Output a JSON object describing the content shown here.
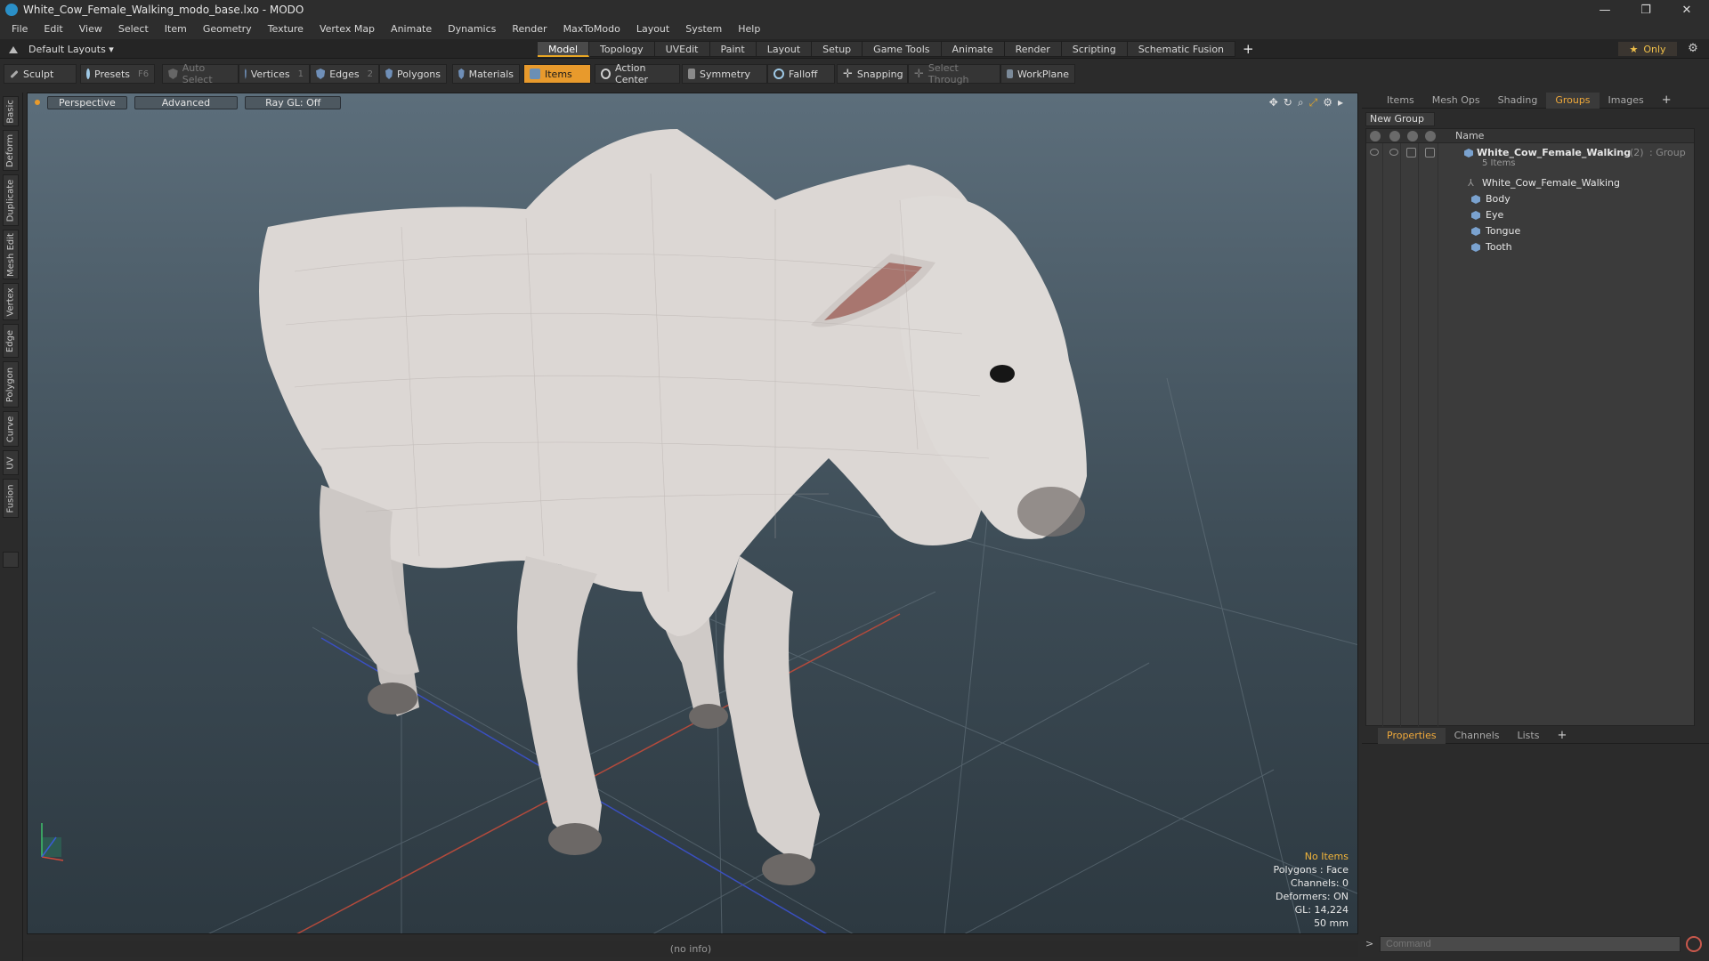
{
  "window": {
    "title": "White_Cow_Female_Walking_modo_base.lxo - MODO",
    "controls": [
      "—",
      "❐",
      "✕"
    ]
  },
  "menu": [
    "File",
    "Edit",
    "View",
    "Select",
    "Item",
    "Geometry",
    "Texture",
    "Vertex Map",
    "Animate",
    "Dynamics",
    "Render",
    "MaxToModo",
    "Layout",
    "System",
    "Help"
  ],
  "layout": {
    "selector": "Default Layouts ▾",
    "tabs": [
      "Model",
      "Topology",
      "UVEdit",
      "Paint",
      "Layout",
      "Setup",
      "Game Tools",
      "Animate",
      "Render",
      "Scripting",
      "Schematic Fusion"
    ],
    "active_tab": "Model",
    "add": "+",
    "only": "Only",
    "star": "★"
  },
  "toolbar": {
    "sculpt": "Sculpt",
    "presets": "Presets",
    "presets_key": "F6",
    "auto_select": "Auto Select",
    "vertices": "Vertices",
    "vertices_key": "1",
    "edges": "Edges",
    "edges_key": "2",
    "polygons": "Polygons",
    "materials": "Materials",
    "items": "Items",
    "action_center": "Action Center",
    "symmetry": "Symmetry",
    "falloff": "Falloff",
    "snapping": "Snapping",
    "select_through": "Select Through",
    "workplane": "WorkPlane"
  },
  "left_tabs": [
    "Basic",
    "Deform",
    "Duplicate",
    "Mesh Edit",
    "Vertex",
    "Edge",
    "Polygon",
    "Curve",
    "UV",
    "Fusion"
  ],
  "viewport": {
    "view": "Perspective",
    "mode": "Advanced",
    "raygl": "Ray GL: Off",
    "info": {
      "items": "No Items",
      "polygons": "Polygons : Face",
      "channels": "Channels: 0",
      "deformers": "Deformers: ON",
      "gl": "GL: 14,224",
      "lens": "50 mm"
    }
  },
  "status": "(no info)",
  "right_panel": {
    "tabs": [
      "Items",
      "Mesh Ops",
      "Shading",
      "Groups",
      "Images"
    ],
    "active_tab": "Groups",
    "add": "+",
    "new_group": "New Group",
    "name_header": "Name",
    "group": {
      "name": "White_Cow_Female_Walking",
      "count": "(2)",
      "type": ": Group",
      "items_label": "5 Items",
      "children": [
        "White_Cow_Female_Walking",
        "Body",
        "Eye",
        "Tongue",
        "Tooth"
      ]
    },
    "bottom_tabs": [
      "Properties",
      "Channels",
      "Lists"
    ],
    "bottom_active": "Properties",
    "command_placeholder": "Command",
    "command_prompt": ">"
  },
  "colors": {
    "accent": "#e89a2c",
    "viewport_top": "#5c6e7b",
    "viewport_bottom": "#2d3941",
    "cow_body": "#dcd7d4",
    "hoof": "#6c6866",
    "ear_inner": "#a8766f"
  }
}
